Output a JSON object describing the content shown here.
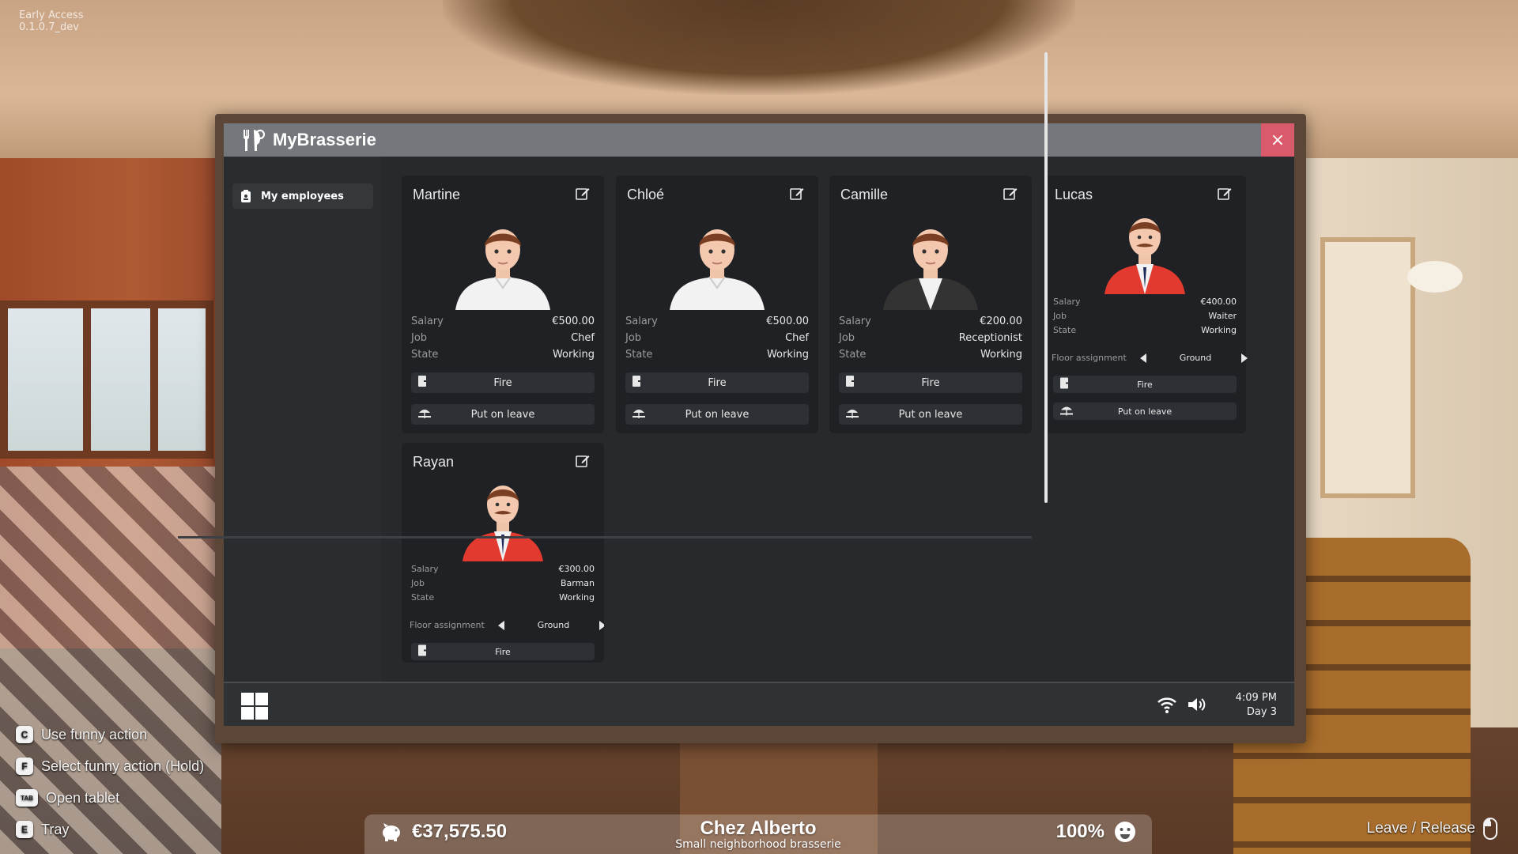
{
  "version": {
    "line1": "Early Access",
    "line2": "0.1.0.7_dev"
  },
  "app": {
    "title": "MyBrasserie",
    "close": "×"
  },
  "sidebar": {
    "items": [
      {
        "label": "My employees"
      }
    ]
  },
  "labels": {
    "salary": "Salary",
    "job": "Job",
    "state": "State",
    "floor": "Floor assignment",
    "fire": "Fire",
    "leave": "Put on leave"
  },
  "employees": [
    {
      "name": "Martine",
      "salary": "€500.00",
      "job": "Chef",
      "state": "Working"
    },
    {
      "name": "Chloé",
      "salary": "€500.00",
      "job": "Chef",
      "state": "Working"
    },
    {
      "name": "Camille",
      "salary": "€200.00",
      "job": "Receptionist",
      "state": "Working"
    },
    {
      "name": "Lucas",
      "salary": "€400.00",
      "job": "Waiter",
      "state": "Working",
      "floor": "Ground"
    },
    {
      "name": "Rayan",
      "salary": "€300.00",
      "job": "Barman",
      "state": "Working",
      "floor": "Ground"
    }
  ],
  "taskbar": {
    "time": "4:09 PM",
    "day": "Day 3"
  },
  "hints": [
    {
      "key": "C",
      "label": "Use funny action"
    },
    {
      "key": "F",
      "label": "Select funny action (Hold)"
    },
    {
      "key": "TAB",
      "label": "Open tablet"
    },
    {
      "key": "E",
      "label": "Tray"
    }
  ],
  "hud": {
    "money": "€37,575.50",
    "restaurant": "Chez Alberto",
    "subtitle": "Small neighborhood brasserie",
    "satisfaction": "100%",
    "leave_release": "Leave / Release"
  },
  "colors": {
    "close": "#d95a6a",
    "screen": "#2d3033",
    "card": "#1f2124",
    "waiter_vest": "#e23a2e"
  }
}
